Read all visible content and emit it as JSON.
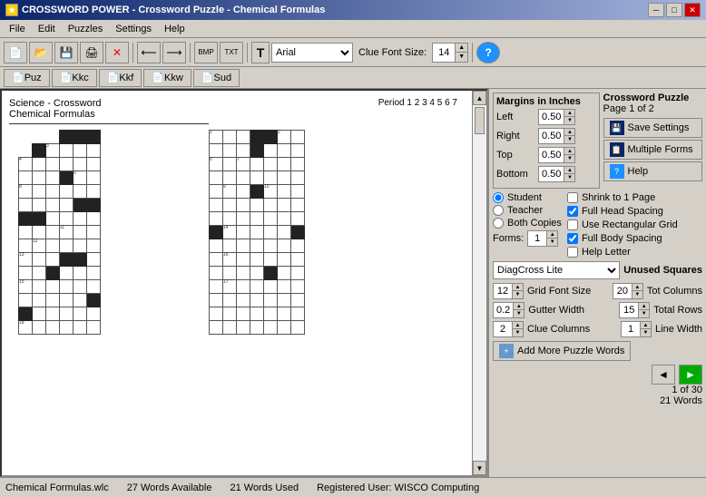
{
  "titlebar": {
    "title": "CROSSWORD POWER - Crossword Puzzle - Chemical Formulas",
    "icon": "★"
  },
  "menubar": {
    "items": [
      "File",
      "Edit",
      "Puzzles",
      "Settings",
      "Help"
    ]
  },
  "toolbar": {
    "font": "Arial",
    "clue_font_label": "Clue Font Size:",
    "clue_font_size": "14",
    "help_icon": "?"
  },
  "tabs": [
    "Puz",
    "Kkc",
    "Kkf",
    "Kkw",
    "Sud"
  ],
  "puzzle": {
    "title1": "Science - Crossword",
    "title2": "Chemical Formulas",
    "period_label": "Period",
    "periods": "1 2 3 4 5 6 7"
  },
  "margins": {
    "title": "Margins in Inches",
    "left_label": "Left",
    "left_val": "0.50",
    "right_label": "Right",
    "right_val": "0.50",
    "top_label": "Top",
    "top_val": "0.50",
    "bottom_label": "Bottom",
    "bottom_val": "0.50"
  },
  "crossword_puzzle": {
    "title": "Crossword Puzzle",
    "subtitle": "Page 1 of 2",
    "save_btn": "Save Settings",
    "multiple_btn": "Multiple Forms",
    "help_btn": "Help"
  },
  "options": {
    "student_label": "Student",
    "teacher_label": "Teacher",
    "both_label": "Both Copies",
    "forms_label": "Forms:",
    "forms_val": "1",
    "shrink_label": "Shrink to 1 Page",
    "full_head_label": "Full Head Spacing",
    "rect_grid_label": "Use Rectangular Grid",
    "full_body_label": "Full Body Spacing",
    "help_letter_label": "Help Letter",
    "shrink_checked": false,
    "full_head_checked": true,
    "rect_grid_checked": false,
    "full_body_checked": true,
    "student_selected": true,
    "teacher_selected": false,
    "both_selected": false
  },
  "diagcross": {
    "label": "DiagCross Lite",
    "unused_label": "Unused Squares"
  },
  "grid_settings": {
    "grid_font_size_label": "Grid Font Size",
    "grid_font_val": "12",
    "tot_columns_label": "Tot Columns",
    "tot_columns_val": "20",
    "gutter_label": "Gutter Width",
    "gutter_val": "0.2",
    "total_rows_label": "Total Rows",
    "total_rows_val": "15",
    "clue_columns_label": "Clue Columns",
    "clue_columns_val": "2",
    "line_width_label": "Line Width",
    "line_width_val": "1"
  },
  "add_words_btn": "Add More Puzzle Words",
  "nav": {
    "left_arrow": "◄",
    "right_arrow": "►"
  },
  "counts": {
    "line1": "1 of 30",
    "line2": "21 Words"
  },
  "statusbar": {
    "file": "Chemical Formulas.wlc",
    "words_available": "27 Words Available",
    "words_used": "21 Words Used",
    "registered": "Registered User: WISCO Computing"
  }
}
